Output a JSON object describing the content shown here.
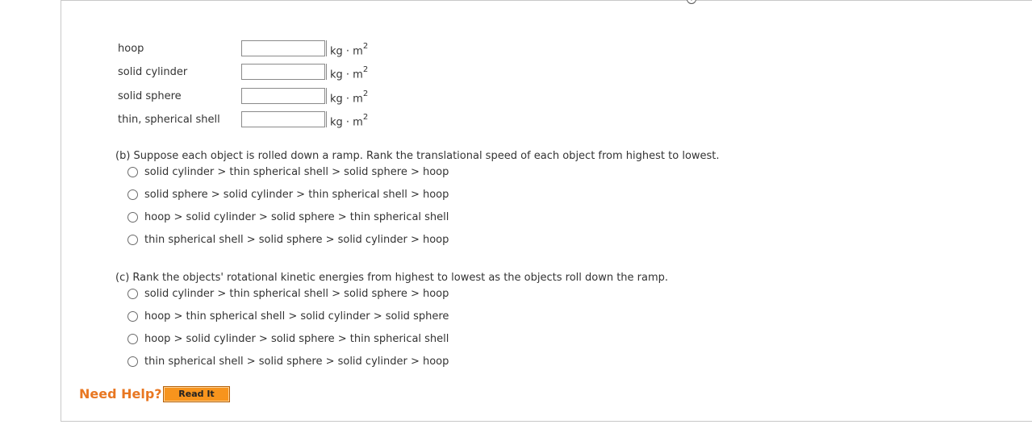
{
  "info_icon": "info-icon",
  "colors": {
    "need_help": "#e87722",
    "button_bg": "#f7941d"
  },
  "part_a": {
    "unit_main": "kg · m",
    "unit_exp": "2",
    "rows": [
      {
        "label": "hoop",
        "value": ""
      },
      {
        "label": "solid cylinder",
        "value": ""
      },
      {
        "label": "solid sphere",
        "value": ""
      },
      {
        "label": "thin, spherical shell",
        "value": ""
      }
    ]
  },
  "part_b": {
    "question": "(b) Suppose each object is rolled down a ramp. Rank the translational speed of each object from highest to lowest.",
    "options": [
      "solid cylinder > thin spherical shell > solid sphere > hoop",
      "solid sphere > solid cylinder > thin spherical shell > hoop",
      "hoop > solid cylinder > solid sphere > thin spherical shell",
      "thin spherical shell > solid sphere > solid cylinder > hoop"
    ]
  },
  "part_c": {
    "question": "(c) Rank the objects' rotational kinetic energies from highest to lowest as the objects roll down the ramp.",
    "options": [
      "solid cylinder > thin spherical shell > solid sphere > hoop",
      "hoop > thin spherical shell > solid cylinder > solid sphere",
      "hoop > solid cylinder > solid sphere > thin spherical shell",
      "thin spherical shell > solid sphere > solid cylinder > hoop"
    ]
  },
  "help": {
    "label": "Need Help?",
    "button": "Read It"
  }
}
